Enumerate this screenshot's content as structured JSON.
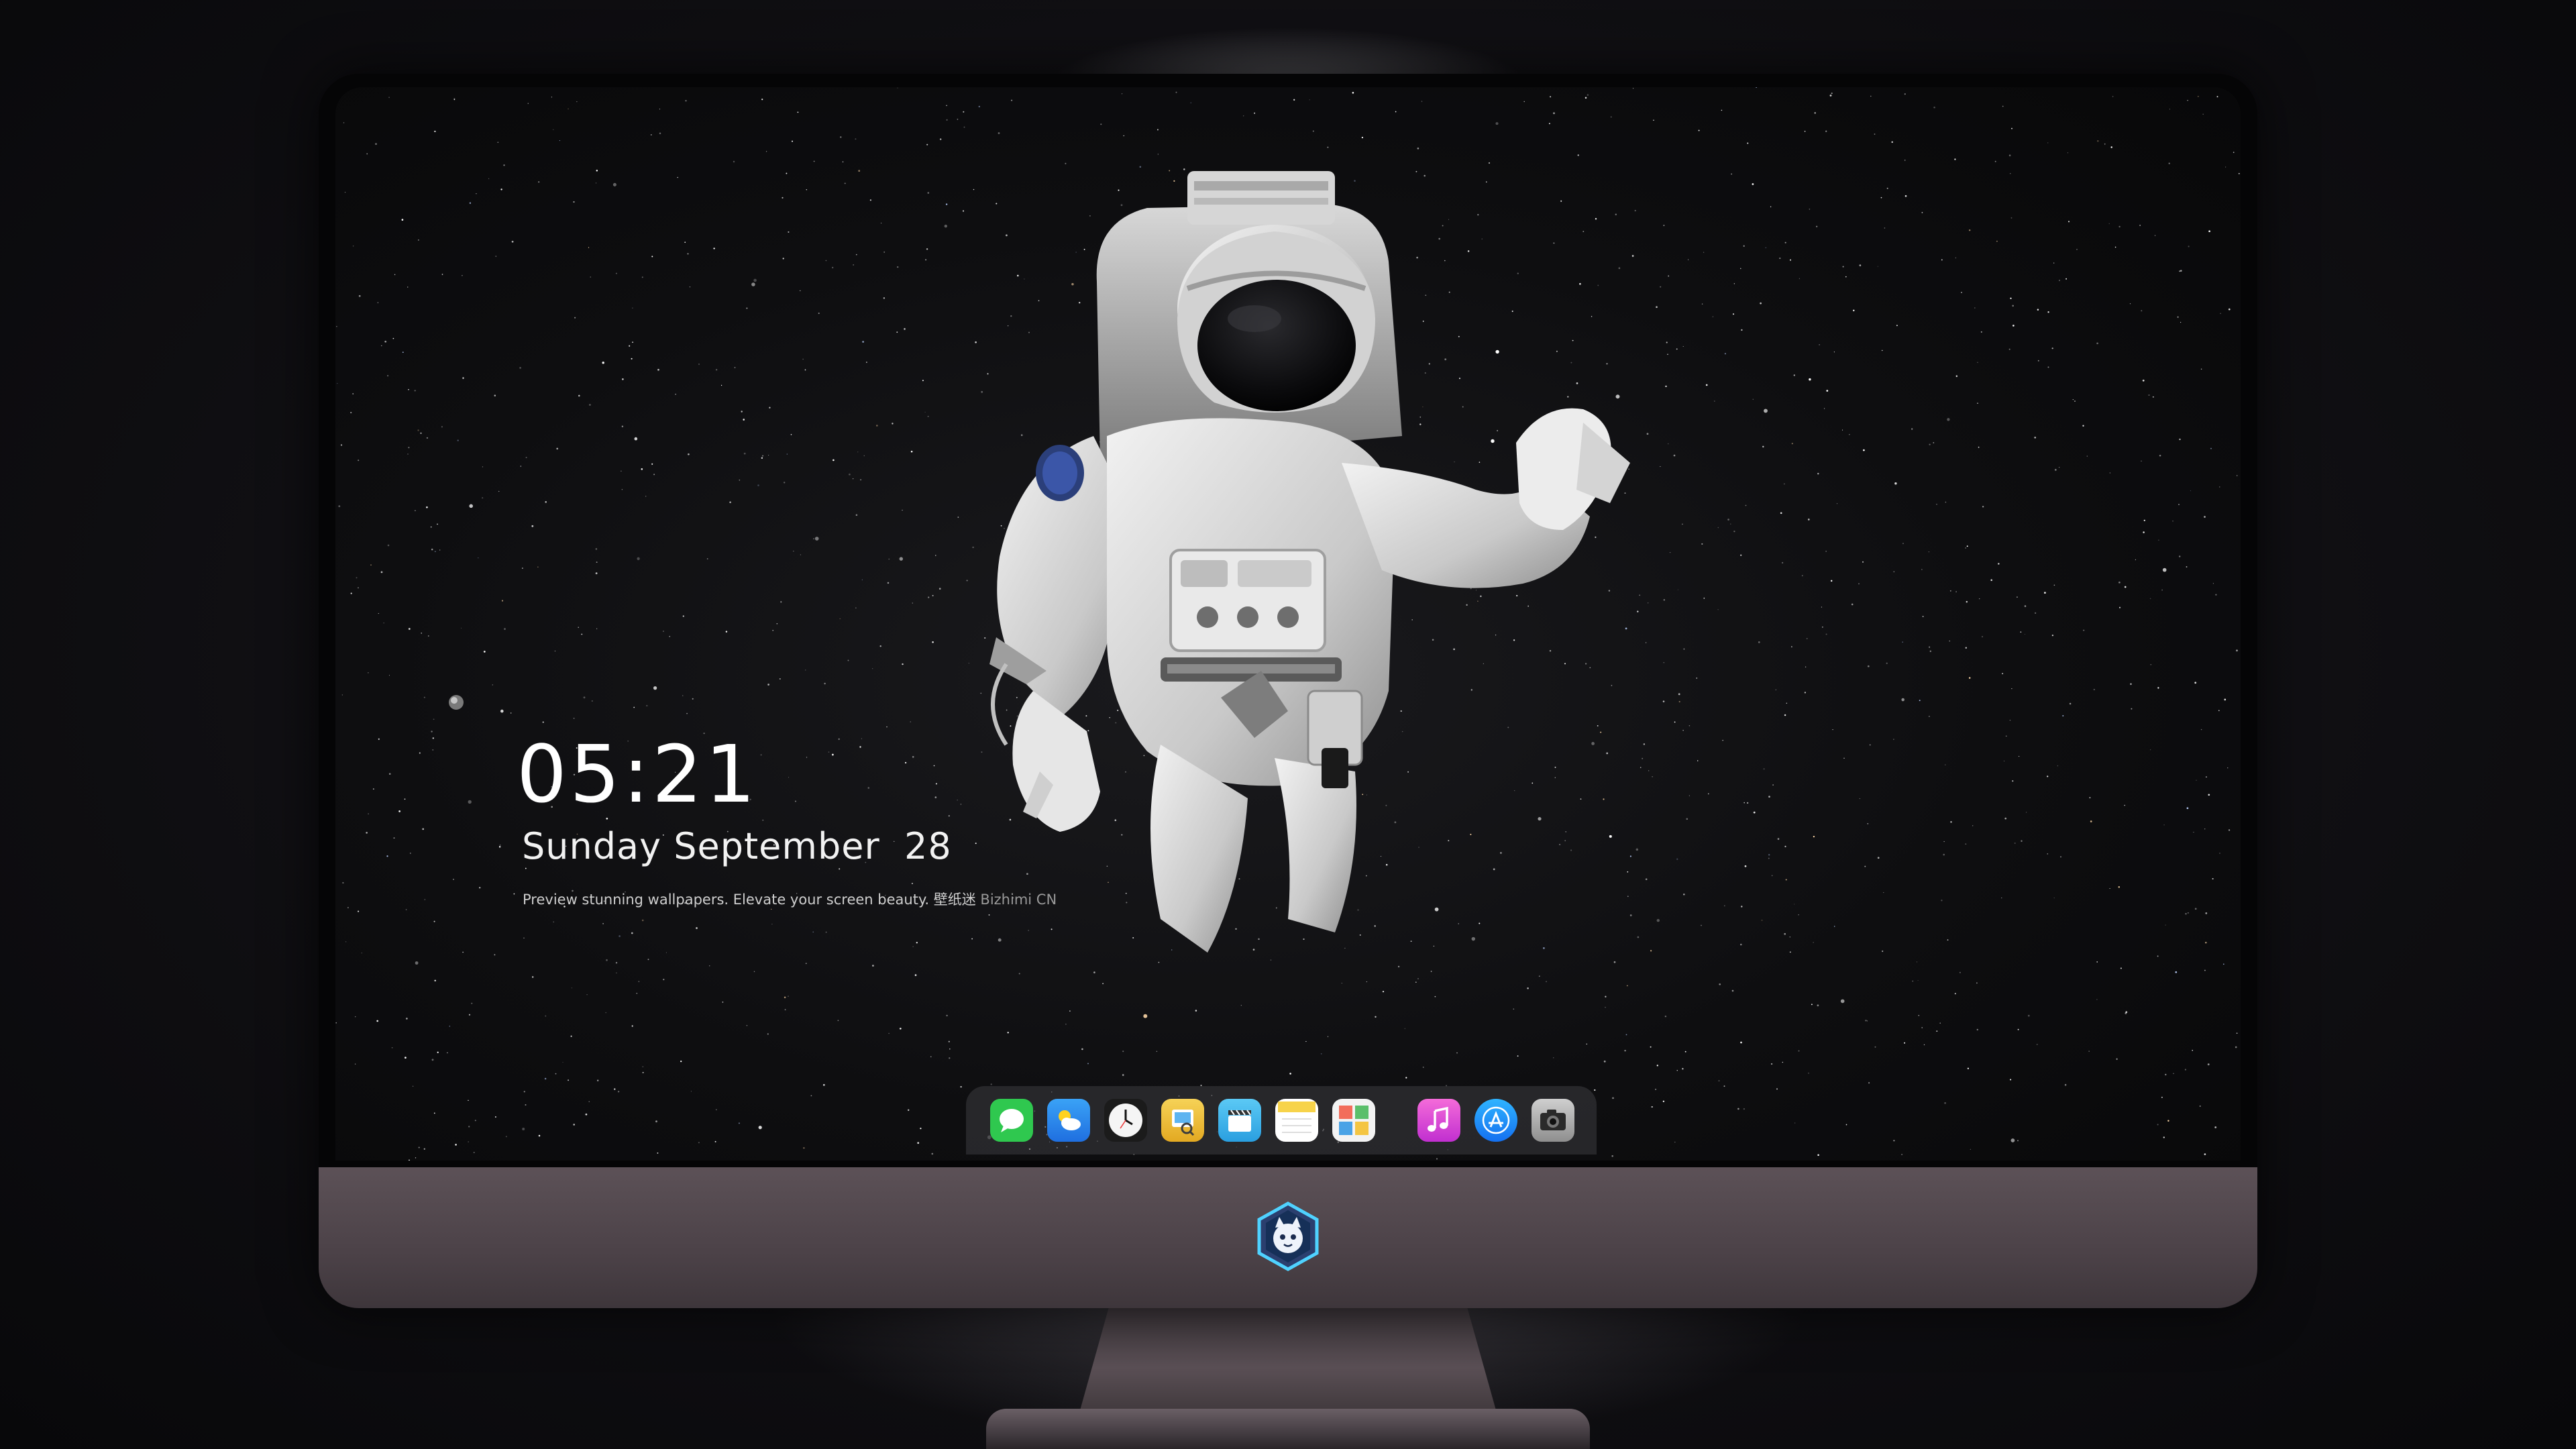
{
  "lockscreen": {
    "time": "05:21",
    "date": "Sunday September  28",
    "tagline": "Preview stunning wallpapers. Elevate your screen beauty. 壁纸迷",
    "brand": "Bizhimi CN"
  },
  "dock": {
    "group_main": [
      {
        "name": "messages-icon",
        "color": "#2fc84f"
      },
      {
        "name": "weather-icon",
        "color": "#3b8ff0"
      },
      {
        "name": "clock-icon",
        "color": "#f4f4f4"
      },
      {
        "name": "preview-icon",
        "color": "#f2c230"
      },
      {
        "name": "clips-icon",
        "color": "#42b4ea"
      },
      {
        "name": "notes-icon",
        "color": "#f7d34a"
      },
      {
        "name": "photo-booth-icon",
        "color": "#f0f0f0"
      }
    ],
    "group_extra": [
      {
        "name": "music-icon",
        "color": "#e34dd0"
      },
      {
        "name": "app-store-icon",
        "color": "#1e90ff"
      },
      {
        "name": "camera-icon",
        "color": "#9a9a9a"
      }
    ]
  }
}
